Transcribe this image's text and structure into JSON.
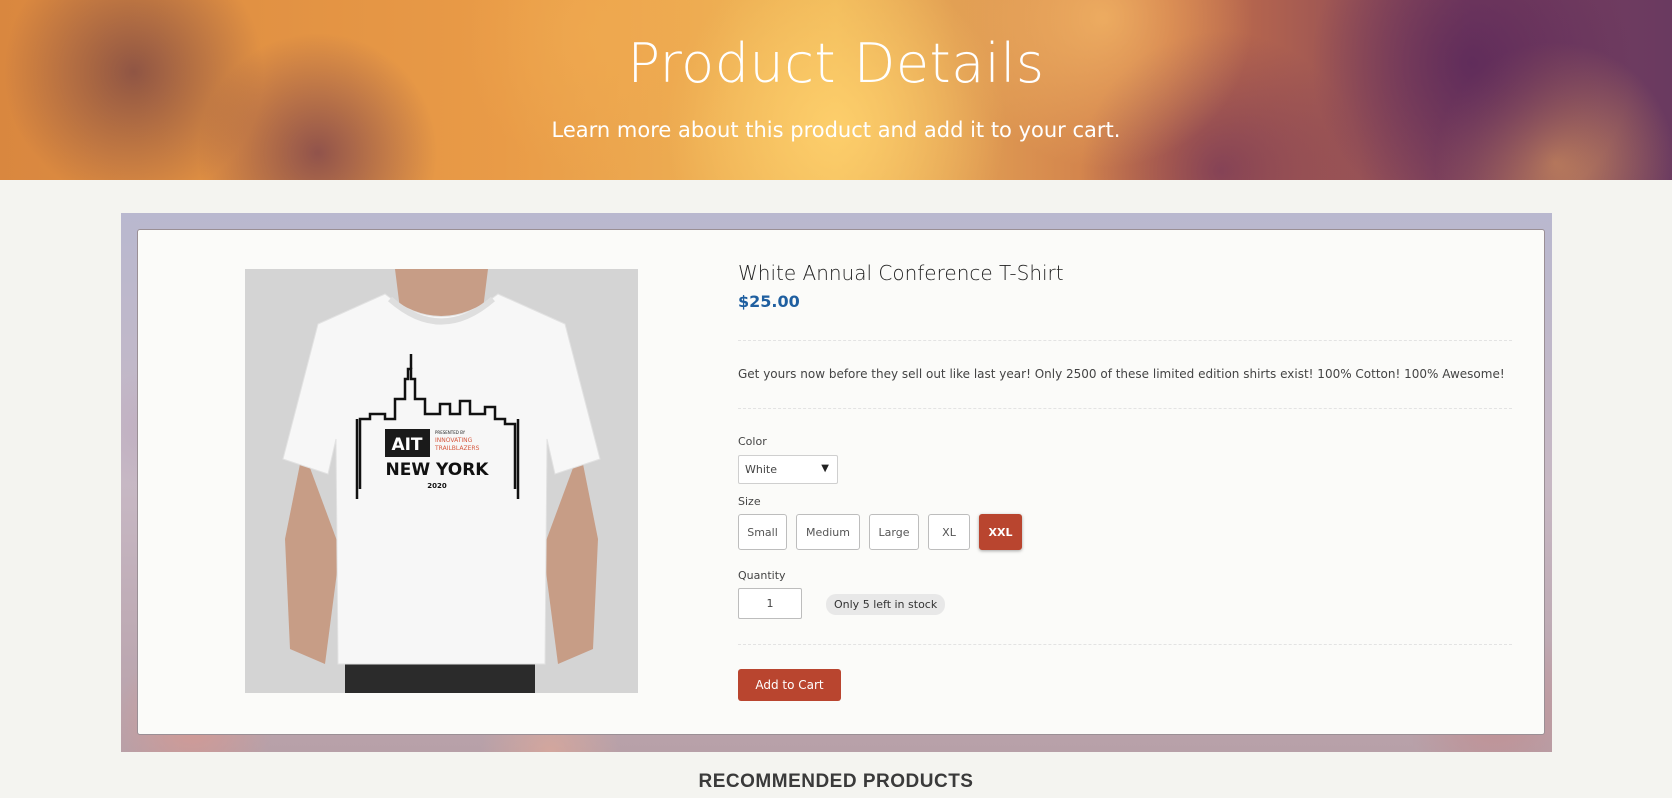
{
  "hero": {
    "title": "Product Details",
    "subtitle": "Learn more about this product and add it to your cart."
  },
  "product": {
    "name": "White Annual Conference T-Shirt",
    "price": "$25.00",
    "description": "Get yours now before they sell out like last year! Only 2500 of these limited edition shirts exist! 100% Cotton! 100% Awesome!",
    "image_text": {
      "logo": "AIT",
      "tagline_small": "PRESENTED BY",
      "tagline_1": "INNOVATING",
      "tagline_2": "TRAILBLAZERS",
      "city": "NEW YORK",
      "year": "2020"
    }
  },
  "options": {
    "color_label": "Color",
    "color_value": "White",
    "size_label": "Size",
    "sizes": [
      "Small",
      "Medium",
      "Large",
      "XL",
      "XXL"
    ],
    "selected_size": "XXL",
    "quantity_label": "Quantity",
    "quantity_value": "1",
    "stock_text": "Only 5 left in stock"
  },
  "actions": {
    "add_to_cart": "Add to Cart"
  },
  "sections": {
    "recommended": "RECOMMENDED PRODUCTS"
  },
  "colors": {
    "accent": "#b9452f",
    "price": "#1f5fa0"
  }
}
